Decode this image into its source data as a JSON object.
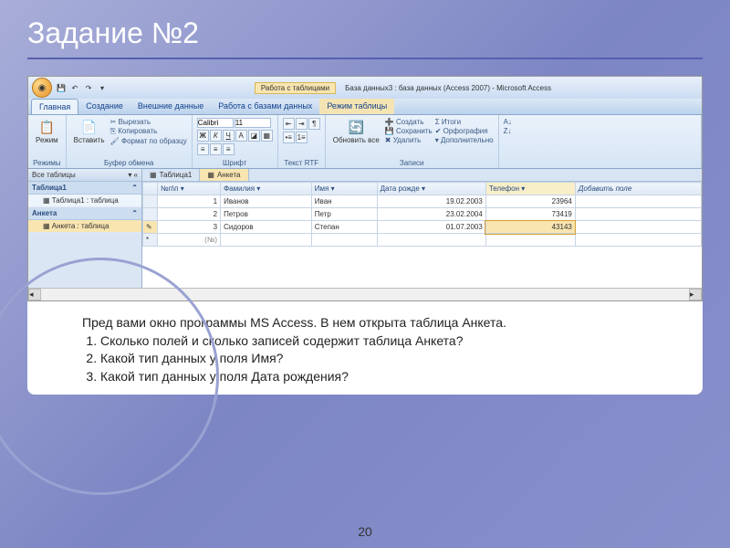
{
  "slide": {
    "title": "Задание №2",
    "page_number": "20"
  },
  "app": {
    "context_tab_label": "Работа с таблицами",
    "title": "База данных3 : база данных (Access 2007) - Microsoft Access",
    "tabs": {
      "home": "Главная",
      "create": "Создание",
      "external": "Внешние данные",
      "dbtools": "Работа с базами данных",
      "table_mode": "Режим таблицы"
    },
    "ribbon": {
      "view": {
        "label": "Режим",
        "group": "Режимы"
      },
      "paste": {
        "label": "Вставить",
        "cut": "Вырезать",
        "copy": "Копировать",
        "format": "Формат по образцу",
        "group": "Буфер обмена"
      },
      "font": {
        "name": "Calibri",
        "size": "11",
        "group": "Шрифт"
      },
      "rtf": {
        "group": "Текст RTF"
      },
      "records": {
        "refresh": "Обновить все",
        "new": "Создать",
        "save": "Сохранить",
        "delete": "Удалить",
        "totals": "Итоги",
        "spelling": "Орфография",
        "more": "Дополнительно",
        "group": "Записи"
      }
    },
    "nav": {
      "header": "Все таблицы",
      "group1": "Таблица1",
      "item1": "Таблица1 : таблица",
      "group2": "Анкета",
      "item2": "Анкета : таблица"
    },
    "doc_tabs": {
      "t1": "Таблица1",
      "t2": "Анкета"
    },
    "table": {
      "columns": [
        "№п\\п",
        "Фамилия",
        "Имя",
        "Дата рожде",
        "Телефон",
        "Добавить поле"
      ],
      "rows": [
        {
          "n": "1",
          "fam": "Иванов",
          "name": "Иван",
          "date": "19.02.2003",
          "tel": "23964"
        },
        {
          "n": "2",
          "fam": "Петров",
          "name": "Петр",
          "date": "23.02.2004",
          "tel": "73419"
        },
        {
          "n": "3",
          "fam": "Сидоров",
          "name": "Степан",
          "date": "01.07.2003",
          "tel": "43143"
        }
      ],
      "new_row_placeholder": "(№)"
    }
  },
  "questions": {
    "intro": "Пред вами окно программы MS Access. В нем открыта таблица Анкета.",
    "q1": "Сколько полей и сколько записей содержит таблица Анкета?",
    "q2": "Какой тип данных у поля Имя?",
    "q3": "Какой тип данных у поля Дата рождения?"
  }
}
